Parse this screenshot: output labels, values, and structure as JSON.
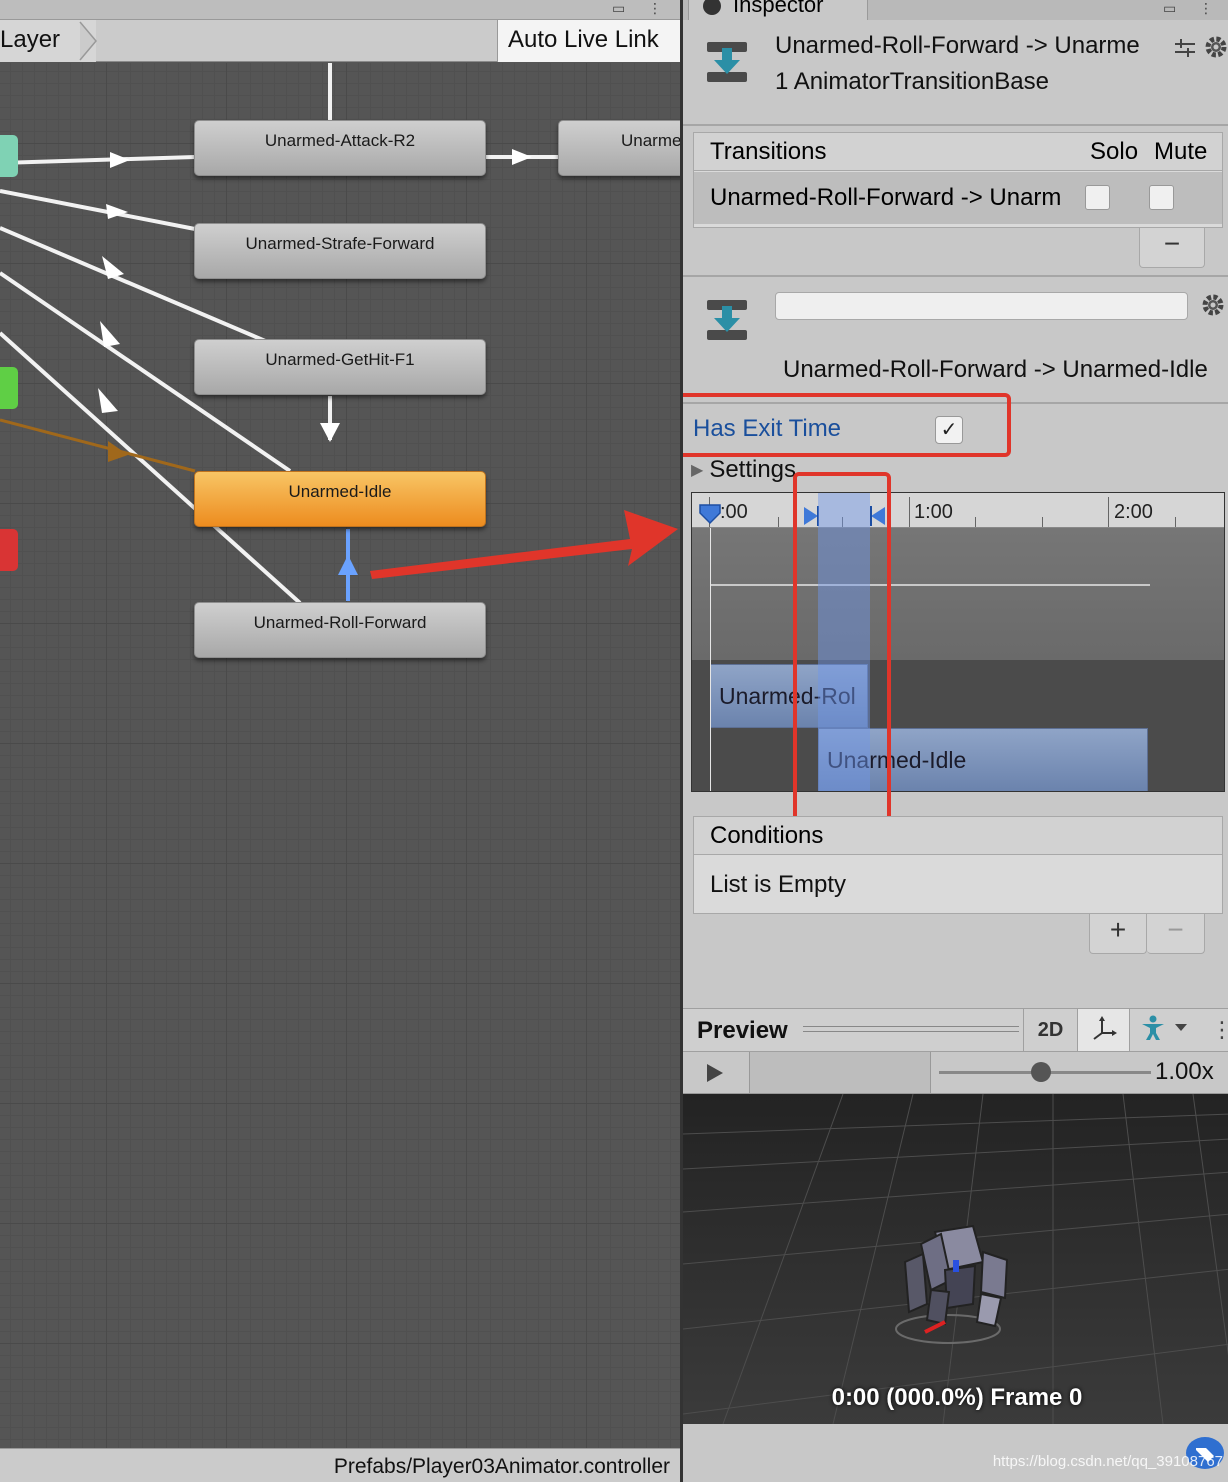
{
  "animator": {
    "breadcrumb_layer": "Layer",
    "auto_live_link": "Auto Live Link",
    "controller_path": "Prefabs/Player03Animator.controller",
    "states": [
      {
        "name": "Unarmed-Attack-R2"
      },
      {
        "name": "Unarme"
      },
      {
        "name": "Unarmed-Strafe-Forward"
      },
      {
        "name": "Unarmed-GetHit-F1"
      },
      {
        "name": "Unarmed-Idle"
      },
      {
        "name": "Unarmed-Roll-Forward"
      }
    ],
    "colors": {
      "default_state": "#ed8c1f",
      "selected_transition": "#6aa2ff",
      "annotation_red": "#e0352a"
    }
  },
  "inspector": {
    "tab_label": "Inspector",
    "header_title": "Unarmed-Roll-Forward -> Unarme",
    "header_subtitle": "1 AnimatorTransitionBase",
    "transitions_list": {
      "header": "Transitions",
      "solo_label": "Solo",
      "mute_label": "Mute",
      "rows": [
        {
          "label": "Unarmed-Roll-Forward -> Unarm",
          "solo": false,
          "mute": false
        }
      ],
      "remove_label": "−"
    },
    "transition_full_name": "Unarmed-Roll-Forward -> Unarmed-Idle",
    "has_exit_time_label": "Has Exit Time",
    "has_exit_time_checked": "✓",
    "settings_label": "Settings",
    "timeline": {
      "tick_labels": [
        ":00",
        "1:00",
        "2:00"
      ],
      "clips": [
        "Unarmed-Rol",
        "Unarmed-Idle"
      ]
    },
    "conditions": {
      "header": "Conditions",
      "empty_text": "List is Empty",
      "add_label": "+",
      "remove_label": "−"
    },
    "preview": {
      "title": "Preview",
      "btn_2d": "2D",
      "speed": "1.00x",
      "frame_readout": "0:00 (000.0%) Frame 0"
    },
    "watermark": "https://blog.csdn.net/qq_39108767"
  }
}
